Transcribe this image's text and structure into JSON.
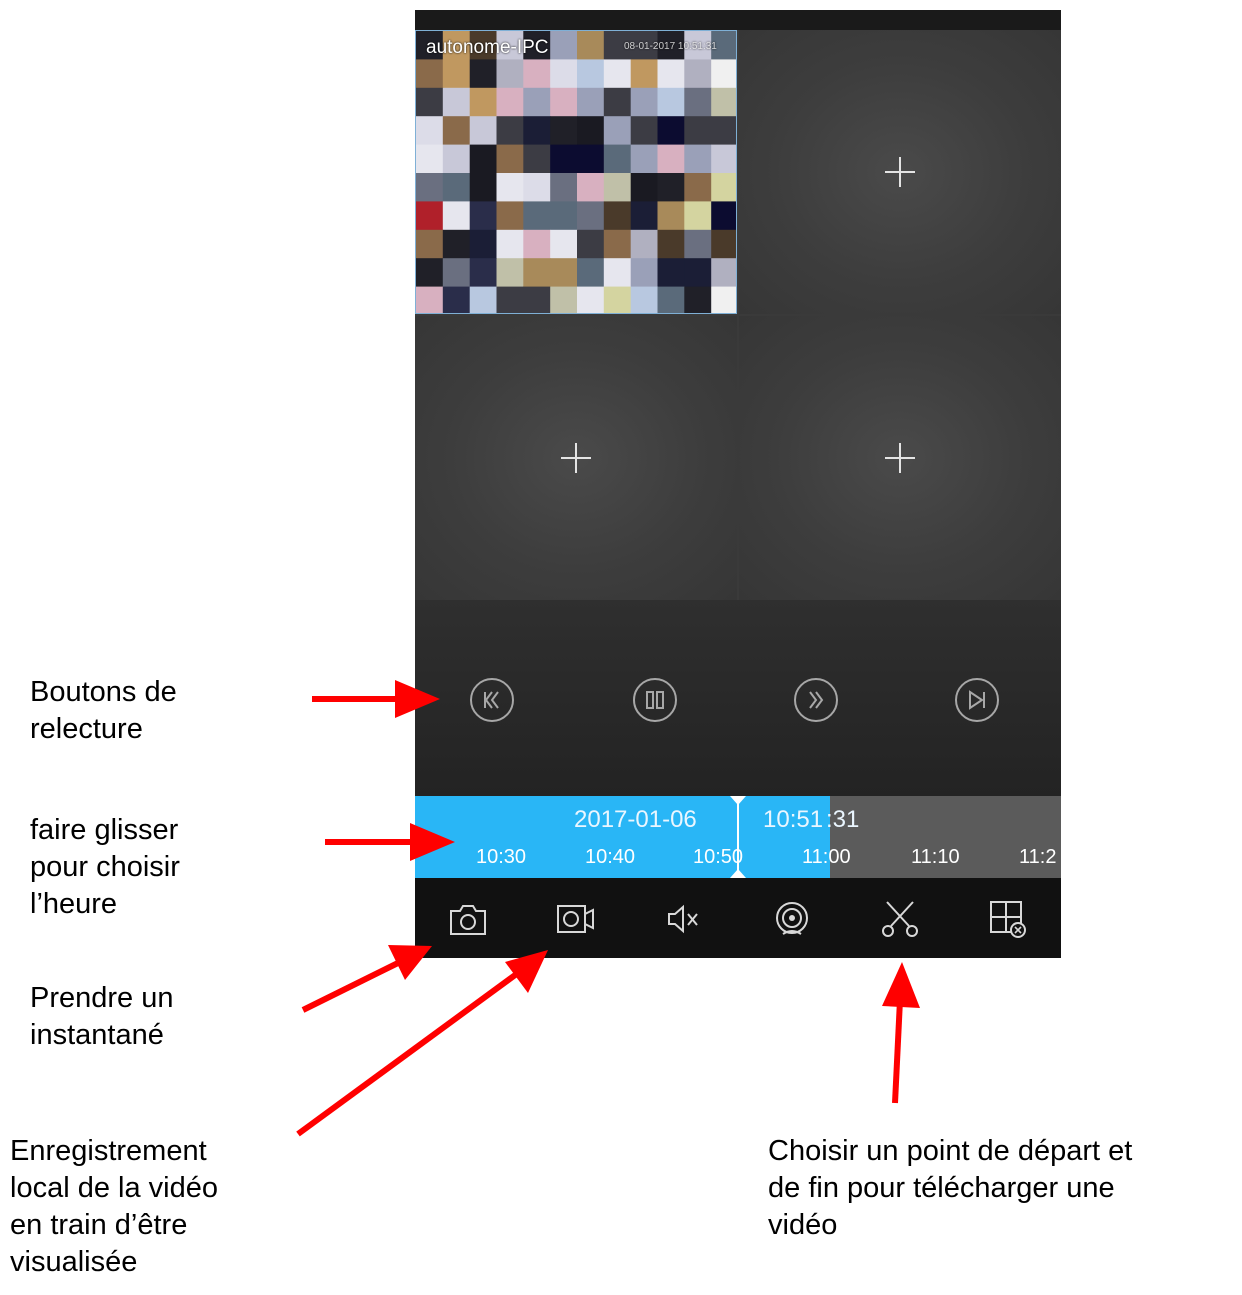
{
  "camera": {
    "name": "autonome-IPC",
    "overlay_time": "08-01-2017 10:51:31"
  },
  "grid": {
    "empty_slot_icon": "plus-icon"
  },
  "playback": {
    "buttons": [
      "rewind-icon",
      "pause-icon",
      "fast-forward-icon",
      "next-frame-icon"
    ]
  },
  "timeline": {
    "date": "2017-01-06",
    "time_prefix": "10:51",
    "time_suffix": ":31",
    "ticks": [
      "10:30",
      "10:40",
      "10:50",
      "11:00",
      "11:10",
      "11:2"
    ],
    "fill_color": "#29b6f6"
  },
  "toolbar": {
    "icons": [
      "camera-snapshot-icon",
      "video-record-icon",
      "mute-icon",
      "webcam-icon",
      "scissors-icon",
      "close-grid-icon"
    ]
  },
  "annotations": {
    "playback": "Boutons de\nrelecture",
    "drag": "faire glisser\npour choisir\nl’heure",
    "snapshot": "Prendre un\ninstantané",
    "record": "Enregistrement\nlocal de la vidéo\nen train d’être\nvisualisée",
    "cut": "Choisir un point de départ et\nde fin pour télécharger une\nvidéo"
  },
  "colors": {
    "arrow": "#ff0000",
    "timeline_accent": "#29b6f6"
  }
}
